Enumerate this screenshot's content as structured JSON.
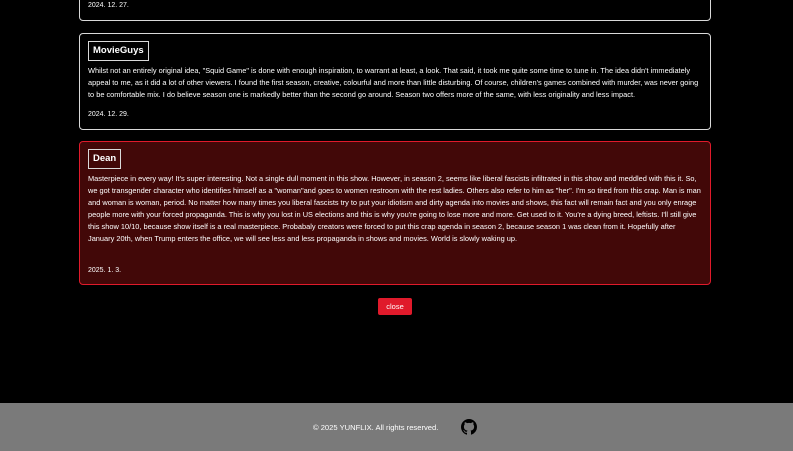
{
  "reviews": [
    {
      "author": "",
      "text": "",
      "date": "2024. 12. 27."
    },
    {
      "author": "MovieGuys",
      "text": "Whilst not an entirely original idea, \"Squid Game\" is done with enough inspiration, to warrant at least, a look. That said, it took me quite some time to tune in. The idea didn't immediately appeal to me, as it did a lot of other viewers. I found the first season, creative, colourful and more than little disturbing. Of course, children's games combined with murder, was never going to be comfortable mix. I do believe season one is markedly better than the second go around. Season two offers more of the same, with less originality and less impact.",
      "date": "2024. 12. 29."
    },
    {
      "author": "Dean",
      "text": "Masterpiece in every way! It's super interesting. Not a single dull moment in this show. However, in season 2, seems like liberal fascists infiltrated in this show and meddled with this it. So, we got transgender character who identifies himself as a \"woman\"and goes to women restroom with the rest ladies. Others also refer to him as \"her\". I'm so tired from this crap. Man is man and woman is woman, period. No matter how many times you liberal fascists try to put your idiotism and dirty agenda into movies and shows, this fact will remain fact and you only enrage people more with your forced propaganda. This is why you lost in US elections and this is why you're going to lose more and more. Get used to it. You're a dying breed, leftists. I'll still give this show 10/10, because show itself is a real masterpiece. Probabaly creators were forced to put this crap agenda in season 2, because season 1 was clean from it. Hopefully after January 20th, when Trump enters the office, we will see less and less propaganda in shows and movies. World is slowly waking up.",
      "date": "2025. 1. 3."
    }
  ],
  "close_label": "close",
  "footer": {
    "copyright": "© 2025 YUNFLIX. All rights reserved.",
    "icon": "github-icon"
  },
  "colors": {
    "accent": "#e01a2b",
    "active_review_bg": "#420808",
    "footer_bg": "#7a7a7a",
    "page_bg": "#000000"
  }
}
